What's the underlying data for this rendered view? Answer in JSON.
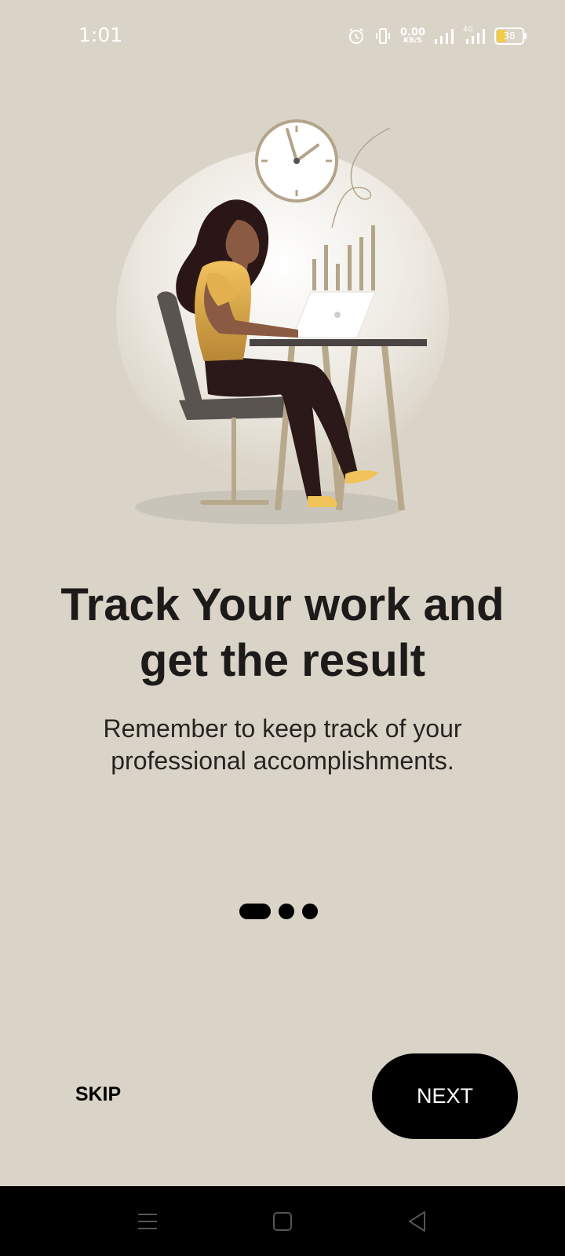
{
  "status_bar": {
    "time": "1:01",
    "net_speed_value": "0.00",
    "net_speed_unit": "KB/S",
    "network_type": "4G",
    "battery_level": "38",
    "icons": [
      "alarm-icon",
      "vibrate-icon",
      "signal-icon",
      "signal-4g-icon",
      "battery-icon"
    ]
  },
  "onboarding": {
    "title_line1": "Track Your work and",
    "title_line2": "get the result",
    "subtitle_line1": "Remember to keep track of your",
    "subtitle_line2": "professional accomplishments.",
    "page_count": 3,
    "active_page": 0
  },
  "actions": {
    "skip_label": "SKIP",
    "next_label": "NEXT"
  },
  "nav_bar": {
    "icons": [
      "menu-icon",
      "home-icon",
      "back-icon"
    ]
  },
  "colors": {
    "background": "#dad4c8",
    "primary_button": "#000000",
    "text": "#1c1b1a",
    "accent_yellow": "#f0c45a",
    "chair": "#5a5450",
    "desk_legs": "#b8a98c"
  }
}
